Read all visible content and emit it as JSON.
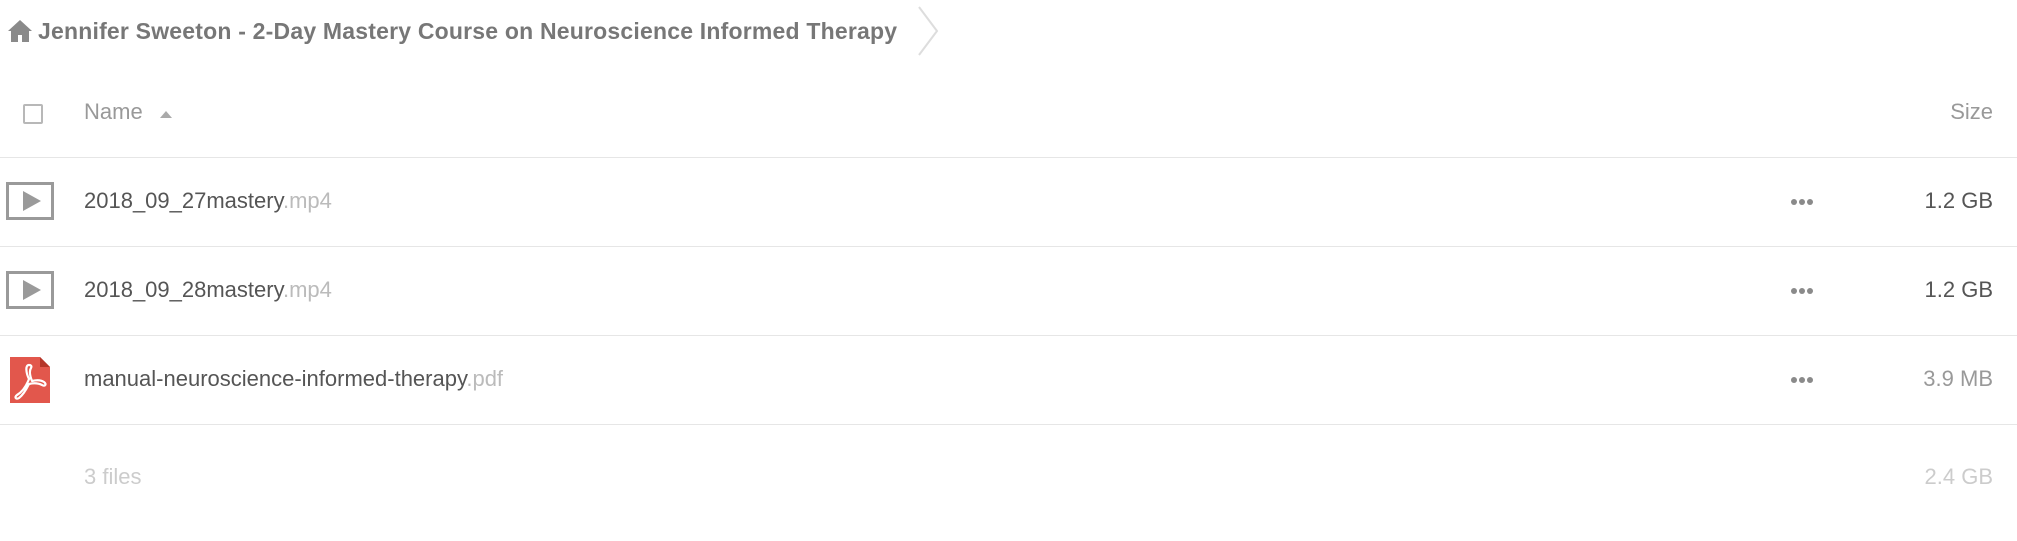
{
  "breadcrumb": {
    "home_icon": "home-icon",
    "title": "Jennifer Sweeton - 2-Day Mastery Course on Neuroscience Informed Therapy"
  },
  "list_header": {
    "name_label": "Name",
    "size_label": "Size",
    "sort_direction": "ascending"
  },
  "files": [
    {
      "basename": "2018_09_27mastery",
      "extension": ".mp4",
      "size": "1.2 GB",
      "icon": "video-file-icon"
    },
    {
      "basename": "2018_09_28mastery",
      "extension": ".mp4",
      "size": "1.2 GB",
      "icon": "video-file-icon"
    },
    {
      "basename": "manual-neuroscience-informed-therapy",
      "extension": ".pdf",
      "size": "3.9 MB",
      "icon": "pdf-file-icon"
    }
  ],
  "summary": {
    "count": "3 files",
    "total_size": "2.4 GB"
  },
  "colors": {
    "pdf_icon": "#e2574c",
    "text": "#555555",
    "muted": "#999999",
    "divider": "#e6e6e6"
  }
}
